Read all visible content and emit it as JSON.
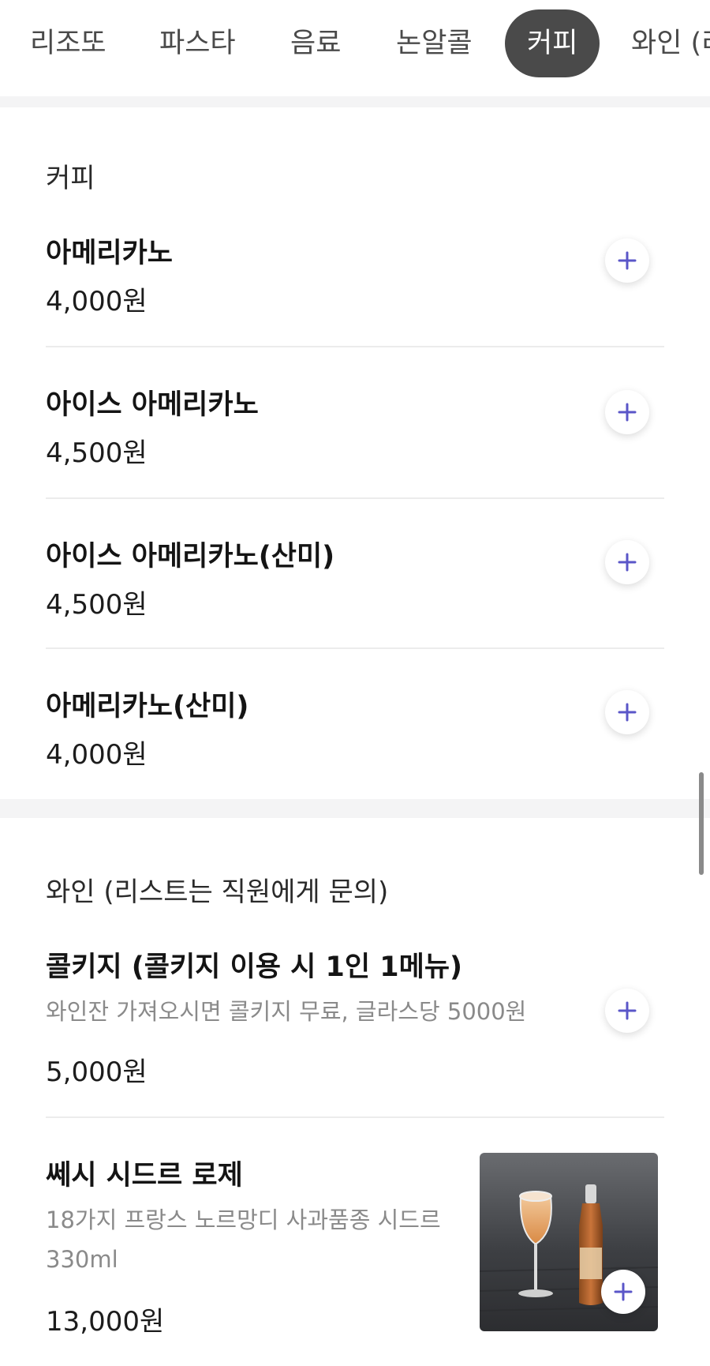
{
  "tabs": [
    {
      "label": "리조또",
      "active": false
    },
    {
      "label": "파스타",
      "active": false
    },
    {
      "label": "음료",
      "active": false
    },
    {
      "label": "논알콜",
      "active": false
    },
    {
      "label": "커피",
      "active": true
    },
    {
      "label": "와인 (리",
      "active": false
    }
  ],
  "sections": [
    {
      "title": "커피",
      "items": [
        {
          "name": "아메리카노",
          "price": "4,000원"
        },
        {
          "name": "아이스 아메리카노",
          "price": "4,500원"
        },
        {
          "name": "아이스 아메리카노(산미)",
          "price": "4,500원"
        },
        {
          "name": "아메리카노(산미)",
          "price": "4,000원"
        }
      ]
    },
    {
      "title": "와인 (리스트는 직원에게 문의)",
      "items": [
        {
          "name": "콜키지 (콜키지 이용 시 1인 1메뉴)",
          "description": "와인잔 가져오시면 콜키지 무료, 글라스당 5000원",
          "price": "5,000원"
        },
        {
          "name": "쎄시 시드르 로제",
          "description": "18가지 프랑스 노르망디 사과품종 시드르\n330ml",
          "price": "13,000원",
          "image": "cider-glass-and-bottle-photo"
        }
      ]
    }
  ],
  "icons": {
    "add": "plus-icon"
  },
  "colors": {
    "accent": "#5a56c8",
    "active_tab": "#4a4a4a",
    "band": "#f4f4f5"
  }
}
